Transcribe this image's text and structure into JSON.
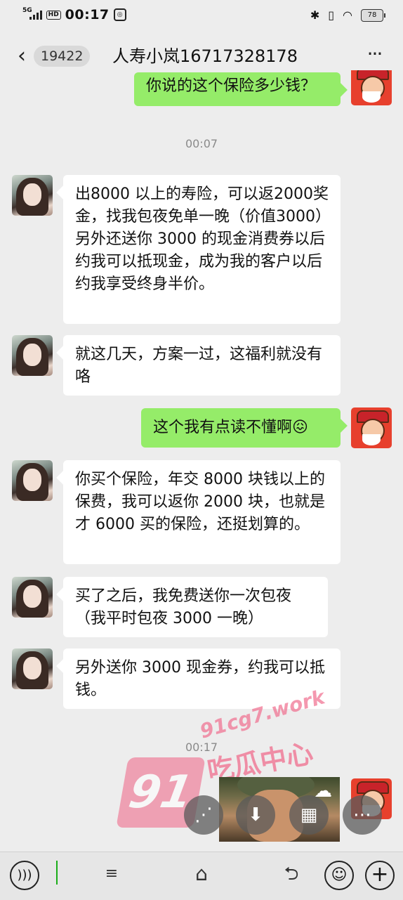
{
  "status_bar": {
    "network": "5G",
    "hd": "HD",
    "time": "00:17",
    "battery": "78"
  },
  "header": {
    "unread_count": "19422",
    "title": "人寿小岚16717328178",
    "more": "···"
  },
  "messages": [
    {
      "side": "right",
      "text": "你说的这个保险多少钱？"
    },
    {
      "type": "time",
      "text": "00:07"
    },
    {
      "side": "left",
      "text": "出8000 以上的寿险，可以返2000奖金，找我包夜免单一晚（价值3000）另外还送你 3000 的现金消费券以后约我可以抵现金，成为我的客户以后约我享受终身半价。"
    },
    {
      "side": "left",
      "text": "就这几天，方案一过，这福利就没有咯"
    },
    {
      "side": "right",
      "text": "这个我有点读不懂啊😖"
    },
    {
      "side": "left",
      "text": "你买个保险，年交 8000 块钱以上的保费，我可以返你 2000 块，也就是才 6000 买的保险，还挺划算的。"
    },
    {
      "side": "left",
      "text": "买了之后，我免费送你一次包夜（我平时包夜 3000 一晚）"
    },
    {
      "side": "left",
      "text": "另外送你 3000 现金券，约我可以抵钱。"
    },
    {
      "type": "time",
      "text": "00:17"
    }
  ],
  "watermark": {
    "logo": "91",
    "site": "91cg7.work",
    "name": "吃瓜中心"
  },
  "colors": {
    "background": "#ededed",
    "bubble_right": "#95ec69",
    "bubble_left": "#ffffff",
    "watermark": "#f06d8e"
  },
  "icons": {
    "back": "chevron-left-icon",
    "more": "more-dots-icon",
    "voice": "voice-icon",
    "menu": "menu-icon",
    "home": "home-icon",
    "back_nav": "back-nav-icon",
    "emoji": "emoji-icon",
    "plus": "plus-icon"
  }
}
